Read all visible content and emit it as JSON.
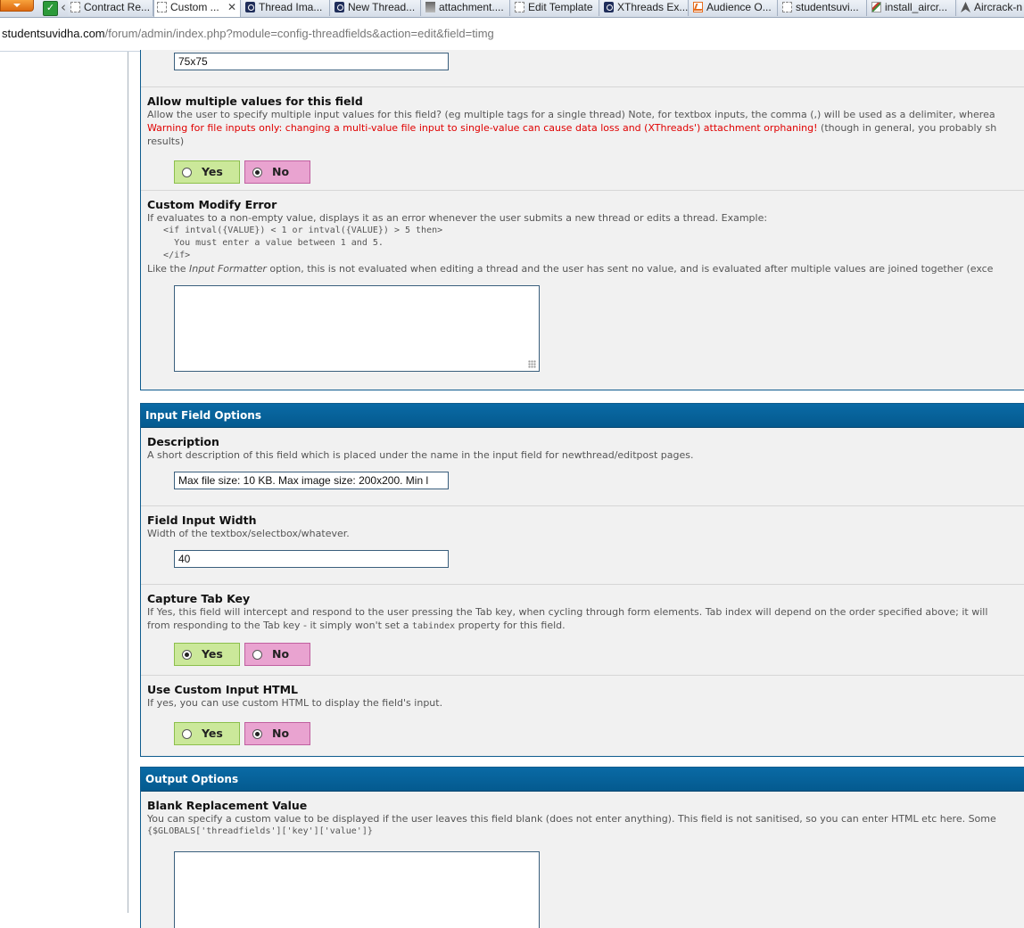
{
  "browser": {
    "tabs": [
      {
        "label": "Contract Re...",
        "icon": "document-icon"
      },
      {
        "label": "Custom ...",
        "icon": "document-icon",
        "active": true
      },
      {
        "label": "Thread Ima...",
        "icon": "forum-icon"
      },
      {
        "label": "New Thread...",
        "icon": "forum-icon"
      },
      {
        "label": "attachment....",
        "icon": "image-icon"
      },
      {
        "label": "Edit Template",
        "icon": "document-icon"
      },
      {
        "label": "XThreads Ex...",
        "icon": "forum-icon"
      },
      {
        "label": "Audience O...",
        "icon": "analytics-icon"
      },
      {
        "label": "studentsuvi...",
        "icon": "document-icon"
      },
      {
        "label": "install_aircr...",
        "icon": "edit-icon"
      },
      {
        "label": "Aircrack-n",
        "icon": "jet-icon"
      }
    ],
    "url_host": "studentsuvidha.com",
    "url_path": "/forum/admin/index.php?module=config-threadfields&action=edit&field=timg"
  },
  "top_group": {
    "size_value": "75x75",
    "multi": {
      "label": "Allow multiple values for this field",
      "desc1": "Allow the user to specify multiple input values for this field? (eg multiple tags for a single thread) Note, for textbox inputs, the comma (,) will be used as a delimiter, wherea",
      "warning": "Warning for file inputs only: changing a multi-value file input to single-value can cause data loss and (XThreads') attachment orphaning!",
      "desc2_tail": " (though in general, you probably sh",
      "desc3": "results)",
      "yes": "Yes",
      "no": "No"
    },
    "modify_error": {
      "label": "Custom Modify Error",
      "desc1": "If evaluates to a non-empty value, displays it as an error whenever the user submits a new thread or edits a thread. Example:",
      "code1": "   <if intval({VALUE}) < 1 or intval({VALUE}) > 5 then>",
      "code2": "     You must enter a value between 1 and 5.",
      "code3": "   </if>",
      "desc2_pre": "Like the ",
      "desc2_em": "Input Formatter",
      "desc2_post": " option, this is not evaluated when editing a thread and the user has sent no value, and is evaluated after multiple values are joined together (exce"
    }
  },
  "input_group": {
    "title": "Input Field Options",
    "description": {
      "label": "Description",
      "desc": "A short description of this field which is placed under the name in the input field for newthread/editpost pages.",
      "value": "Max file size: 10 KB. Max image size: 200x200. Min l"
    },
    "width": {
      "label": "Field Input Width",
      "desc": "Width of the textbox/selectbox/whatever.",
      "value": "40"
    },
    "tabkey": {
      "label": "Capture Tab Key",
      "desc1": "If Yes, this field will intercept and respond to the user pressing the Tab key, when cycling through form elements. Tab index will depend on the order specified above; it will",
      "desc2_pre": "from responding to the Tab key - it simply won't set a ",
      "desc2_code": "tabindex",
      "desc2_post": " property for this field.",
      "yes": "Yes",
      "no": "No"
    },
    "custom_html": {
      "label": "Use Custom Input HTML",
      "desc": "If yes, you can use custom HTML to display the field's input.",
      "yes": "Yes",
      "no": "No"
    }
  },
  "output_group": {
    "title": "Output Options",
    "blank": {
      "label": "Blank Replacement Value",
      "desc": "You can specify a custom value to be displayed if the user leaves this field blank (does not enter anything). This field is not sanitised, so you can enter HTML etc here. Some",
      "code": "{$GLOBALS['threadfields']['key']['value']}"
    }
  }
}
